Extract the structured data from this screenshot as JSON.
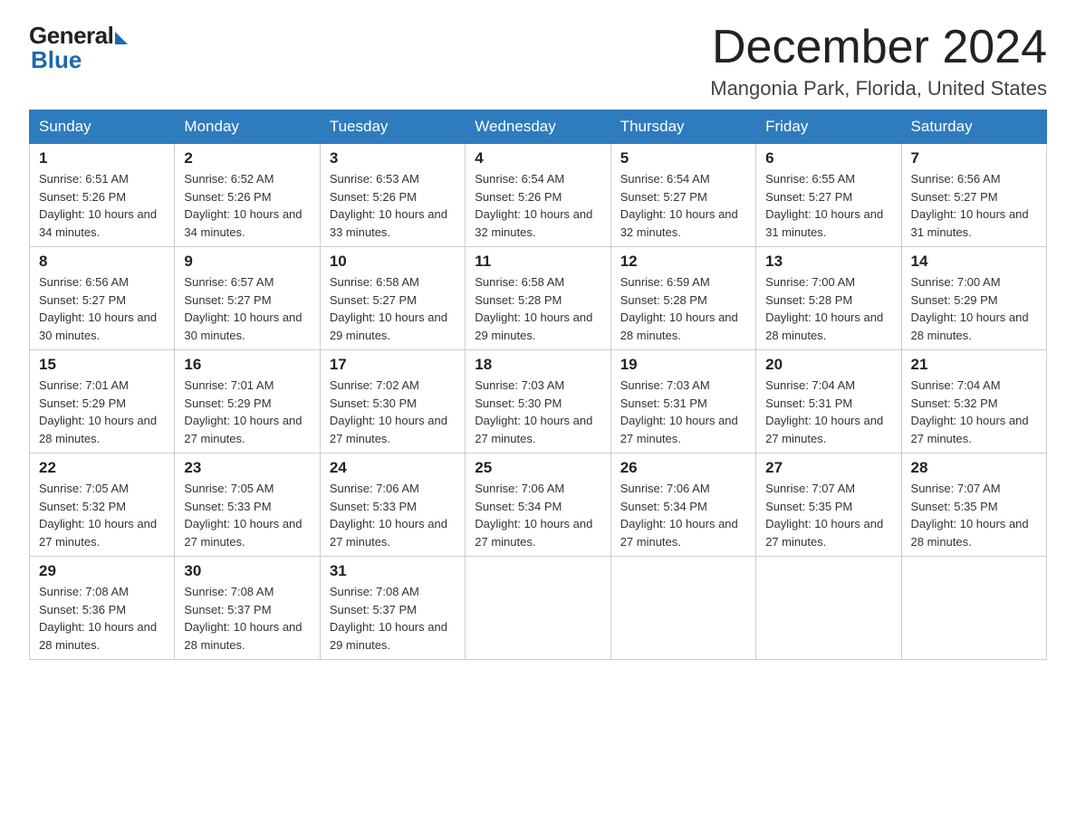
{
  "logo": {
    "general": "General",
    "blue": "Blue"
  },
  "title": "December 2024",
  "location": "Mangonia Park, Florida, United States",
  "weekdays": [
    "Sunday",
    "Monday",
    "Tuesday",
    "Wednesday",
    "Thursday",
    "Friday",
    "Saturday"
  ],
  "weeks": [
    [
      {
        "day": "1",
        "sunrise": "6:51 AM",
        "sunset": "5:26 PM",
        "daylight": "10 hours and 34 minutes."
      },
      {
        "day": "2",
        "sunrise": "6:52 AM",
        "sunset": "5:26 PM",
        "daylight": "10 hours and 34 minutes."
      },
      {
        "day": "3",
        "sunrise": "6:53 AM",
        "sunset": "5:26 PM",
        "daylight": "10 hours and 33 minutes."
      },
      {
        "day": "4",
        "sunrise": "6:54 AM",
        "sunset": "5:26 PM",
        "daylight": "10 hours and 32 minutes."
      },
      {
        "day": "5",
        "sunrise": "6:54 AM",
        "sunset": "5:27 PM",
        "daylight": "10 hours and 32 minutes."
      },
      {
        "day": "6",
        "sunrise": "6:55 AM",
        "sunset": "5:27 PM",
        "daylight": "10 hours and 31 minutes."
      },
      {
        "day": "7",
        "sunrise": "6:56 AM",
        "sunset": "5:27 PM",
        "daylight": "10 hours and 31 minutes."
      }
    ],
    [
      {
        "day": "8",
        "sunrise": "6:56 AM",
        "sunset": "5:27 PM",
        "daylight": "10 hours and 30 minutes."
      },
      {
        "day": "9",
        "sunrise": "6:57 AM",
        "sunset": "5:27 PM",
        "daylight": "10 hours and 30 minutes."
      },
      {
        "day": "10",
        "sunrise": "6:58 AM",
        "sunset": "5:27 PM",
        "daylight": "10 hours and 29 minutes."
      },
      {
        "day": "11",
        "sunrise": "6:58 AM",
        "sunset": "5:28 PM",
        "daylight": "10 hours and 29 minutes."
      },
      {
        "day": "12",
        "sunrise": "6:59 AM",
        "sunset": "5:28 PM",
        "daylight": "10 hours and 28 minutes."
      },
      {
        "day": "13",
        "sunrise": "7:00 AM",
        "sunset": "5:28 PM",
        "daylight": "10 hours and 28 minutes."
      },
      {
        "day": "14",
        "sunrise": "7:00 AM",
        "sunset": "5:29 PM",
        "daylight": "10 hours and 28 minutes."
      }
    ],
    [
      {
        "day": "15",
        "sunrise": "7:01 AM",
        "sunset": "5:29 PM",
        "daylight": "10 hours and 28 minutes."
      },
      {
        "day": "16",
        "sunrise": "7:01 AM",
        "sunset": "5:29 PM",
        "daylight": "10 hours and 27 minutes."
      },
      {
        "day": "17",
        "sunrise": "7:02 AM",
        "sunset": "5:30 PM",
        "daylight": "10 hours and 27 minutes."
      },
      {
        "day": "18",
        "sunrise": "7:03 AM",
        "sunset": "5:30 PM",
        "daylight": "10 hours and 27 minutes."
      },
      {
        "day": "19",
        "sunrise": "7:03 AM",
        "sunset": "5:31 PM",
        "daylight": "10 hours and 27 minutes."
      },
      {
        "day": "20",
        "sunrise": "7:04 AM",
        "sunset": "5:31 PM",
        "daylight": "10 hours and 27 minutes."
      },
      {
        "day": "21",
        "sunrise": "7:04 AM",
        "sunset": "5:32 PM",
        "daylight": "10 hours and 27 minutes."
      }
    ],
    [
      {
        "day": "22",
        "sunrise": "7:05 AM",
        "sunset": "5:32 PM",
        "daylight": "10 hours and 27 minutes."
      },
      {
        "day": "23",
        "sunrise": "7:05 AM",
        "sunset": "5:33 PM",
        "daylight": "10 hours and 27 minutes."
      },
      {
        "day": "24",
        "sunrise": "7:06 AM",
        "sunset": "5:33 PM",
        "daylight": "10 hours and 27 minutes."
      },
      {
        "day": "25",
        "sunrise": "7:06 AM",
        "sunset": "5:34 PM",
        "daylight": "10 hours and 27 minutes."
      },
      {
        "day": "26",
        "sunrise": "7:06 AM",
        "sunset": "5:34 PM",
        "daylight": "10 hours and 27 minutes."
      },
      {
        "day": "27",
        "sunrise": "7:07 AM",
        "sunset": "5:35 PM",
        "daylight": "10 hours and 27 minutes."
      },
      {
        "day": "28",
        "sunrise": "7:07 AM",
        "sunset": "5:35 PM",
        "daylight": "10 hours and 28 minutes."
      }
    ],
    [
      {
        "day": "29",
        "sunrise": "7:08 AM",
        "sunset": "5:36 PM",
        "daylight": "10 hours and 28 minutes."
      },
      {
        "day": "30",
        "sunrise": "7:08 AM",
        "sunset": "5:37 PM",
        "daylight": "10 hours and 28 minutes."
      },
      {
        "day": "31",
        "sunrise": "7:08 AM",
        "sunset": "5:37 PM",
        "daylight": "10 hours and 29 minutes."
      },
      null,
      null,
      null,
      null
    ]
  ]
}
